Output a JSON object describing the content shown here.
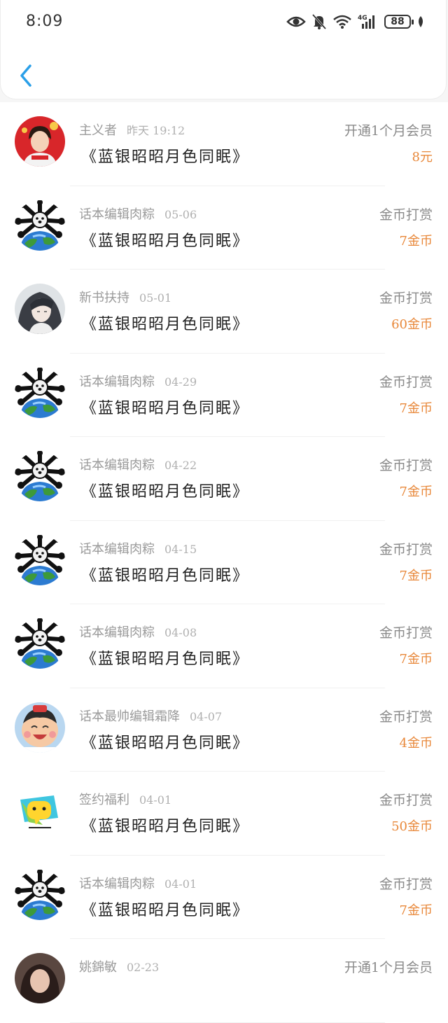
{
  "status_bar": {
    "time": "8:09",
    "battery": "88"
  },
  "records": [
    {
      "name": "主义者",
      "date": "昨天 19:12",
      "book": "《蓝银昭昭月色同眠》",
      "type": "开通1个月会员",
      "amount": "8元",
      "avatar": "avatar-photo-red"
    },
    {
      "name": "话本编辑肉粽",
      "date": "05-06",
      "book": "《蓝银昭昭月色同眠》",
      "type": "金币打赏",
      "amount": "7金币",
      "avatar": "avatar-globe-dog"
    },
    {
      "name": "新书扶持",
      "date": "05-01",
      "book": "《蓝银昭昭月色同眠》",
      "type": "金币打赏",
      "amount": "60金币",
      "avatar": "avatar-anime"
    },
    {
      "name": "话本编辑肉粽",
      "date": "04-29",
      "book": "《蓝银昭昭月色同眠》",
      "type": "金币打赏",
      "amount": "7金币",
      "avatar": "avatar-globe-dog"
    },
    {
      "name": "话本编辑肉粽",
      "date": "04-22",
      "book": "《蓝银昭昭月色同眠》",
      "type": "金币打赏",
      "amount": "7金币",
      "avatar": "avatar-globe-dog"
    },
    {
      "name": "话本编辑肉粽",
      "date": "04-15",
      "book": "《蓝银昭昭月色同眠》",
      "type": "金币打赏",
      "amount": "7金币",
      "avatar": "avatar-globe-dog"
    },
    {
      "name": "话本编辑肉粽",
      "date": "04-08",
      "book": "《蓝银昭昭月色同眠》",
      "type": "金币打赏",
      "amount": "7金币",
      "avatar": "avatar-globe-dog"
    },
    {
      "name": "话本最帅编辑霜降",
      "date": "04-07",
      "book": "《蓝银昭昭月色同眠》",
      "type": "金币打赏",
      "amount": "4金币",
      "avatar": "avatar-cartoon-kid"
    },
    {
      "name": "签约福利",
      "date": "04-01",
      "book": "《蓝银昭昭月色同眠》",
      "type": "金币打赏",
      "amount": "50金币",
      "avatar": "avatar-chat-bubble"
    },
    {
      "name": "话本编辑肉粽",
      "date": "04-01",
      "book": "《蓝银昭昭月色同眠》",
      "type": "金币打赏",
      "amount": "7金币",
      "avatar": "avatar-globe-dog"
    },
    {
      "name": "姚錦敏",
      "date": "02-23",
      "book": "",
      "type": "开通1个月会员",
      "amount": "",
      "avatar": "avatar-photo-dark"
    }
  ],
  "colors": {
    "accent": "#2a9fe8",
    "amount": "#e8883a"
  }
}
